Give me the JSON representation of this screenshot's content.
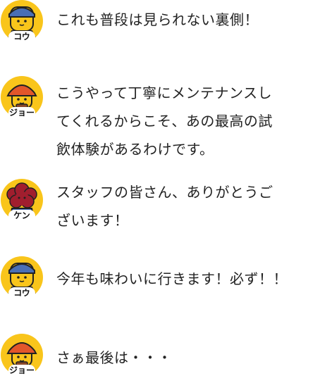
{
  "messages": [
    {
      "speaker": "コウ",
      "text": "これも普段は見られない裏側！"
    },
    {
      "speaker": "ジョー",
      "text": "こうやって丁寧にメンテナンスし\nてくれるからこそ、あの最高の試\n飲体験があるわけです。"
    },
    {
      "speaker": "ケン",
      "text": "スタッフの皆さん、ありがとうご\nざいます！"
    },
    {
      "speaker": "コウ",
      "text": "今年も味わいに行きます！必ず！！"
    },
    {
      "speaker": "ジョー",
      "text": "さぁ最後は・・・"
    }
  ],
  "colors": {
    "avatar_background": "#F9C51B",
    "kou_hat": "#4A6FB5",
    "jo_hat": "#E2562B",
    "ken_hair": "#A11E2E",
    "face": "#F9C51B"
  }
}
